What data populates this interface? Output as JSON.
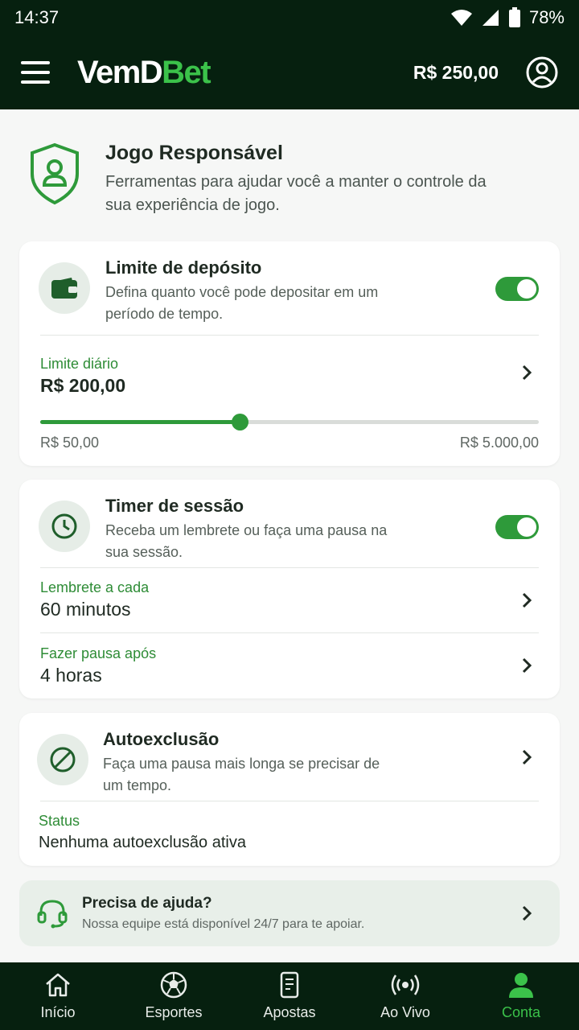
{
  "status_bar": {
    "time": "14:37",
    "battery": "78%"
  },
  "app_bar": {
    "logo_part1": "VemD",
    "logo_part2": "Bet",
    "balance": "R$ 250,00"
  },
  "header": {
    "title": "Jogo Responsável",
    "description": "Ferramentas para ajudar você a manter o controle da sua experiência de jogo."
  },
  "deposit_limit": {
    "title": "Limite de depósito",
    "description": "Defina quanto você pode depositar em um período de tempo.",
    "enabled": true,
    "row_label": "Limite diário",
    "row_value": "R$ 200,00",
    "slider_min": "R$ 50,00",
    "slider_max": "R$ 5.000,00",
    "slider_fraction": 0.4
  },
  "session_timer": {
    "title": "Timer de sessão",
    "description": "Receba um lembrete ou faça uma pausa na sua sessão.",
    "enabled": true,
    "reminder_label": "Lembrete a cada",
    "reminder_value": "60 minutos",
    "pause_label": "Fazer pausa após",
    "pause_value": "4 horas"
  },
  "self_exclusion": {
    "title": "Autoexclusão",
    "description": "Faça uma pausa mais longa se precisar de um tempo.",
    "status_label": "Status",
    "status_value": "Nenhuma autoexclusão ativa"
  },
  "help": {
    "title": "Precisa de ajuda?",
    "description": "Nossa equipe está disponível 24/7 para te apoiar."
  },
  "bottom_nav": {
    "items": [
      {
        "label": "Início",
        "icon": "home-icon"
      },
      {
        "label": "Esportes",
        "icon": "soccer-ball-icon"
      },
      {
        "label": "Apostas",
        "icon": "bet-slip-icon"
      },
      {
        "label": "Ao Vivo",
        "icon": "live-icon"
      },
      {
        "label": "Conta",
        "icon": "account-icon",
        "active": true
      }
    ]
  },
  "colors": {
    "brand_dark": "#06200f",
    "accent": "#3bc24a",
    "primary_green": "#2e9a3a"
  }
}
